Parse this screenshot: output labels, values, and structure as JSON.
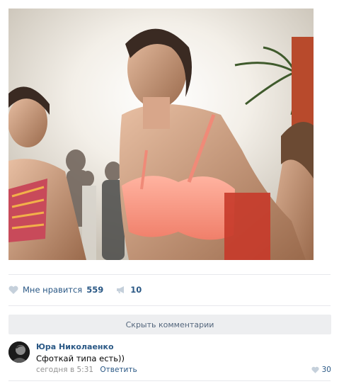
{
  "post": {
    "photo_alt": "photo",
    "like_label": "Мне нравится",
    "like_count": "559",
    "share_count": "10"
  },
  "comments_toggle": {
    "label": "Скрыть комментарии"
  },
  "comment": {
    "author": "Юра Николаенко",
    "text": "Сфоткай типа есть))",
    "time": "сегодня в 5:31",
    "reply_label": "Ответить",
    "like_count": "30"
  },
  "colors": {
    "link": "#2a5885",
    "icon": "#c5d0db",
    "bar": "#edeef0"
  },
  "icons": {
    "like": "heart-icon",
    "share": "megaphone-icon"
  }
}
